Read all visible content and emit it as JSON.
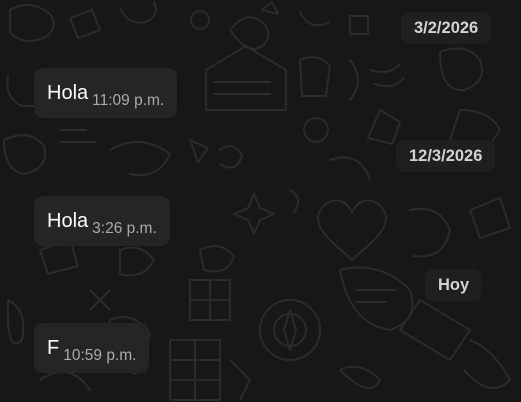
{
  "chat": {
    "date_separators": [
      "3/2/2026",
      "12/3/2026",
      "Hoy"
    ],
    "messages": [
      {
        "text": "Hola",
        "time": "11:09 p.m."
      },
      {
        "text": "Hola",
        "time": "3:26 p.m."
      },
      {
        "text": "F",
        "time": "10:59 p.m."
      }
    ]
  },
  "colors": {
    "background": "#161717",
    "bubble_incoming": "#242626",
    "date_chip": "#1e1f1f",
    "doodle_stroke": "#2a2b2b"
  }
}
